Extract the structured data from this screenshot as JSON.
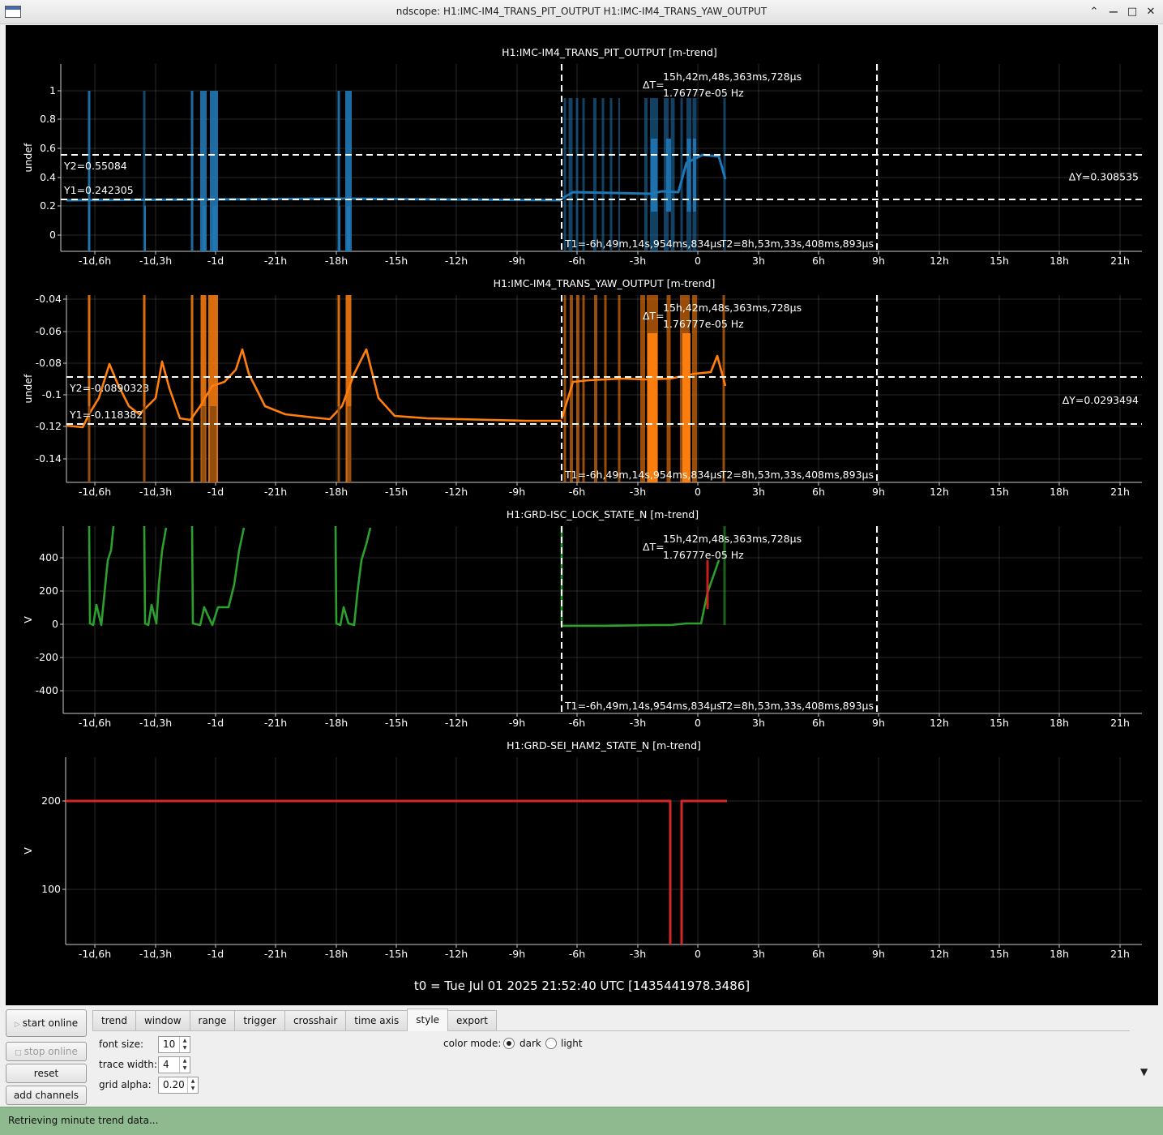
{
  "window": {
    "title": "ndscope: H1:IMC-IM4_TRANS_PIT_OUTPUT H1:IMC-IM4_TRANS_YAW_OUTPUT",
    "minimize": "⌃",
    "maximize": "□",
    "close": "✕"
  },
  "x_ticks": [
    "-1d,6h",
    "-1d,3h",
    "-1d",
    "-21h",
    "-18h",
    "-15h",
    "-12h",
    "-9h",
    "-6h",
    "-3h",
    "0",
    "3h",
    "6h",
    "9h",
    "12h",
    "15h",
    "18h",
    "21h"
  ],
  "plots": [
    {
      "title": "H1:IMC-IM4_TRANS_PIT_OUTPUT [m-trend]",
      "ylabel": "undef",
      "color": "#1f77b4",
      "y_ticks": [
        "1",
        "0.8",
        "0.6",
        "0.4",
        "0.2",
        "0"
      ],
      "cursor_y1": "Y1=0.242305",
      "cursor_y2": "Y2=0.55084",
      "delta_y": "ΔY=0.308535",
      "delta_t_label": "ΔT=",
      "delta_t": "15h,42m,48s,363ms,728µs",
      "delta_t_hz": "1.76777e-05 Hz",
      "t1": "T1=-6h,49m,14s,954ms,834µs",
      "t2": "T2=8h,53m,33s,408ms,893µs"
    },
    {
      "title": "H1:IMC-IM4_TRANS_YAW_OUTPUT [m-trend]",
      "ylabel": "undef",
      "color": "#ff7f0e",
      "y_ticks": [
        "-0.04",
        "-0.06",
        "-0.08",
        "-0.1",
        "-0.12",
        "-0.14"
      ],
      "cursor_y1": "Y1=-0.118382",
      "cursor_y2": "Y2=-0.0890323",
      "delta_y": "ΔY=0.0293494",
      "delta_t_label": "ΔT=",
      "delta_t": "15h,42m,48s,363ms,728µs",
      "delta_t_hz": "1.76777e-05 Hz",
      "t1": "T1=-6h,49m,14s,954ms,834µs",
      "t2": "T2=8h,53m,33s,408ms,893µs"
    },
    {
      "title": "H1:GRD-ISC_LOCK_STATE_N [m-trend]",
      "ylabel": "V",
      "color": "#2ca02c",
      "y_ticks": [
        "400",
        "200",
        "0",
        "-200",
        "-400"
      ],
      "delta_t_label": "ΔT=",
      "delta_t": "15h,42m,48s,363ms,728µs",
      "delta_t_hz": "1.76777e-05 Hz",
      "t1": "T1=-6h,49m,14s,954ms,834µs",
      "t2": "T2=8h,53m,33s,408ms,893µs"
    },
    {
      "title": "H1:GRD-SEI_HAM2_STATE_N [m-trend]",
      "ylabel": "V",
      "color": "#d62728",
      "y_ticks": [
        "200",
        "100"
      ]
    }
  ],
  "t0": "t0 = Tue Jul 01 2025 21:52:40 UTC [1435441978.3486]",
  "controls": {
    "start_online": "start online",
    "stop_online": "stop online",
    "reset": "reset",
    "add_channels": "add channels",
    "tabs": [
      "trend",
      "window",
      "range",
      "trigger",
      "crosshair",
      "time axis",
      "style",
      "export"
    ],
    "active_tab": "style",
    "font_size_label": "font size:",
    "font_size": "10",
    "trace_width_label": "trace width:",
    "trace_width": "4",
    "grid_alpha_label": "grid alpha:",
    "grid_alpha": "0.20",
    "color_mode_label": "color mode:",
    "dark": "dark",
    "light": "light",
    "color_mode": "dark",
    "collapse_icon": "▼"
  },
  "status": "Retrieving minute trend data..."
}
